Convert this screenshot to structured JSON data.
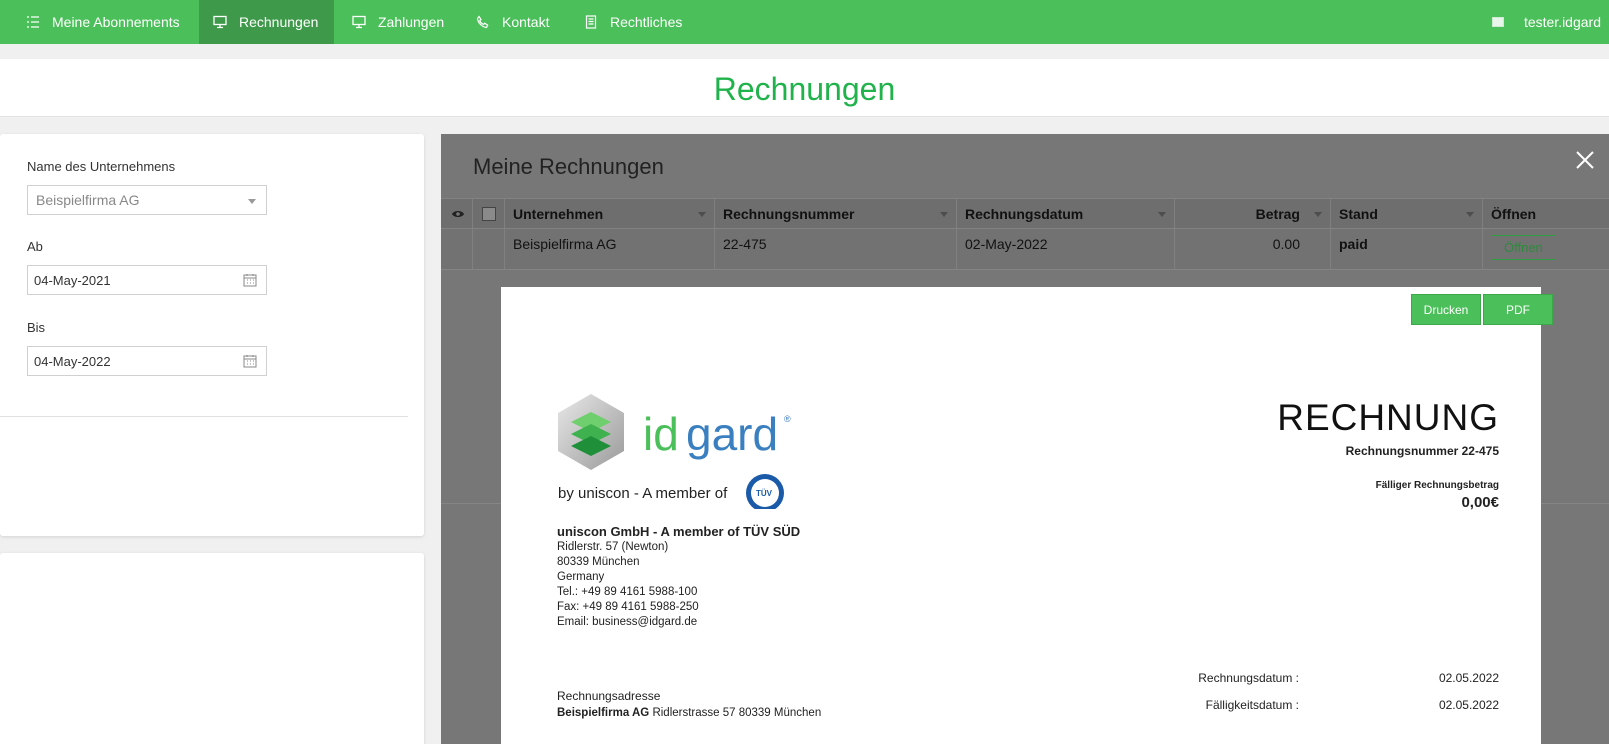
{
  "nav": {
    "items": [
      {
        "label": "Meine Abonnements",
        "icon": "list-icon"
      },
      {
        "label": "Rechnungen",
        "icon": "monitor-icon",
        "active": true
      },
      {
        "label": "Zahlungen",
        "icon": "monitor-icon"
      },
      {
        "label": "Kontakt",
        "icon": "phone-icon"
      },
      {
        "label": "Rechtliches",
        "icon": "document-icon"
      }
    ],
    "user": "tester.idgard"
  },
  "page": {
    "title": "Rechnungen"
  },
  "filters": {
    "company_label": "Name des Unternehmens",
    "company_value": "Beispielfirma AG",
    "from_label": "Ab",
    "from_value": "04-May-2021",
    "to_label": "Bis",
    "to_value": "04-May-2022"
  },
  "modal": {
    "title": "Meine Rechnungen",
    "columns": [
      "Unternehmen",
      "Rechnungsnummer",
      "Rechnungsdatum",
      "Betrag",
      "Stand",
      "Öffnen"
    ],
    "rows": [
      {
        "company": "Beispielfirma AG",
        "number": "22-475",
        "date": "02-May-2022",
        "amount": "0.00",
        "status": "paid",
        "open_label": "Öffnen"
      }
    ]
  },
  "invoice": {
    "print_label": "Drucken",
    "pdf_label": "PDF",
    "logo_text": "idgard",
    "logo_tagline": "by uniscon  -  A member of",
    "company_name": "uniscon GmbH - A member of TÜV SÜD",
    "address": [
      "Ridlerstr. 57 (Newton)",
      "80339 München",
      "Germany",
      "Tel.: +49 89 4161 5988-100",
      "Fax: +49 89 4161 5988-250",
      "Email: business@idgard.de"
    ],
    "title": "RECHNUNG",
    "number_line": "Rechnungsnummer 22-475",
    "due_label": "Fälliger Rechnungsbetrag",
    "due_value": "0,00€",
    "billing_label": "Rechnungsadresse",
    "billing_company": "Beispielfirma AG",
    "billing_address": " Ridlerstrasse 57 80339 München",
    "invoice_date_label": "Rechnungsdatum :",
    "invoice_date_value": "02.05.2022",
    "due_date_label": "Fälligkeitsdatum :",
    "due_date_value": "02.05.2022"
  },
  "colors": {
    "accent": "#4bbf5a",
    "title_green": "#20b34b",
    "overlay": "#777777"
  }
}
